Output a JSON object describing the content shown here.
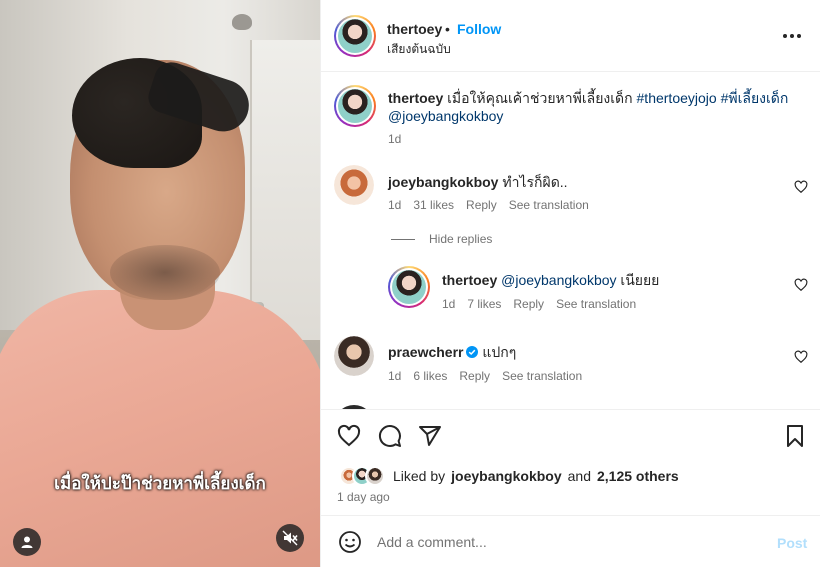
{
  "post": {
    "author": "thertoey",
    "follow_label": "Follow",
    "separator": "•",
    "audio": "เสียงต้นฉบับ",
    "video_subtitle": "เมื่อให้ปะป๊าช่วยหาพี่เลี้ยงเด็ก"
  },
  "caption": {
    "username": "thertoey",
    "text": "เมื่อให้คุณเค้าช่วยหาพี่เลี้ยงเด็ก",
    "tags": [
      "#thertoeyjojo",
      "#พี่เลี้ยงเด็ก"
    ],
    "mention": "@joeybangkokboy",
    "time": "1d"
  },
  "comments": [
    {
      "username": "joeybangkokboy",
      "text": "ทำไรก็ผิด..",
      "time": "1d",
      "likes": "31 likes",
      "reply": "Reply",
      "translate": "See translation",
      "hide_replies": "Hide replies",
      "replies": [
        {
          "username": "thertoey",
          "mention": "@joeybangkokboy",
          "text": "เนียยย",
          "time": "1d",
          "likes": "7 likes",
          "reply": "Reply",
          "translate": "See translation"
        }
      ]
    },
    {
      "username": "praewcherr",
      "verified": true,
      "text": "แปกๆ",
      "time": "1d",
      "likes": "6 likes",
      "reply": "Reply",
      "translate": "See translation"
    }
  ],
  "engagement": {
    "liked_by_prefix": "Liked by",
    "liked_by_user": "joeybangkokboy",
    "and": "and",
    "others": "2,125 others",
    "time_ago": "1 day ago"
  },
  "composer": {
    "placeholder": "Add a comment...",
    "post_label": "Post"
  },
  "colors": {
    "link_blue": "#0095f6",
    "tag_blue": "#00376b",
    "muted": "#737373",
    "post_disabled": "#b2dffc"
  },
  "icons": [
    "more-icon",
    "heart-icon",
    "comment-icon",
    "share-icon",
    "save-icon",
    "emoji-icon",
    "user-icon",
    "mute-icon",
    "verified-badge-icon"
  ]
}
